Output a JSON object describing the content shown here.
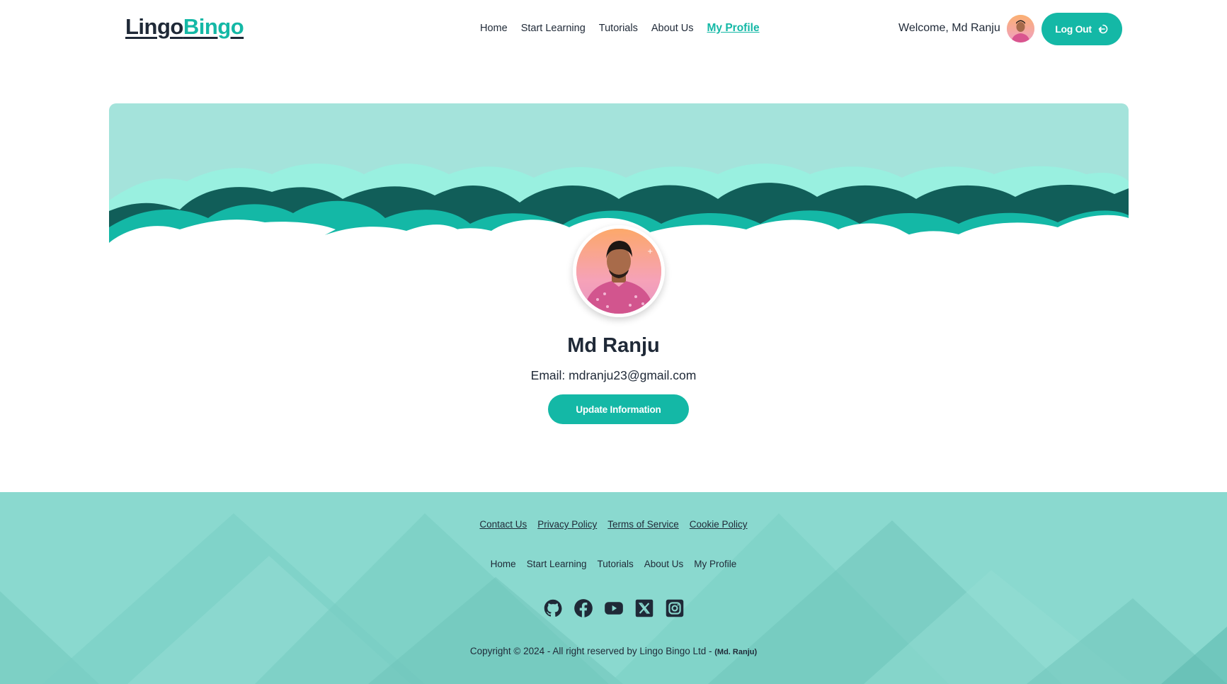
{
  "brand": {
    "part1": "Lingo",
    "part2": "Bingo"
  },
  "nav": [
    {
      "label": "Home"
    },
    {
      "label": "Start Learning"
    },
    {
      "label": "Tutorials"
    },
    {
      "label": "About Us"
    },
    {
      "label": "My Profile",
      "active": true
    }
  ],
  "user": {
    "welcome": "Welcome, Md Ranju"
  },
  "logout": {
    "label": "Log Out"
  },
  "profile": {
    "name": "Md Ranju",
    "email": "Email: mdranju23@gmail.com",
    "update_label": "Update Information"
  },
  "footer": {
    "links": [
      "Contact Us",
      "Privacy Policy",
      "Terms of Service",
      "Cookie Policy"
    ],
    "nav": [
      "Home",
      "Start Learning",
      "Tutorials",
      "About Us",
      "My Profile"
    ],
    "social": [
      "github-icon",
      "facebook-icon",
      "youtube-icon",
      "x-twitter-icon",
      "instagram-icon"
    ],
    "copyright": "Copyright © 2024 - All right reserved by Lingo Bingo Ltd - ",
    "author": "(Md. Ranju)"
  },
  "colors": {
    "accent": "#14b8a6",
    "banner": "#a4e3db",
    "footer": "#8ad9cf",
    "dark_wave": "#115e59"
  }
}
